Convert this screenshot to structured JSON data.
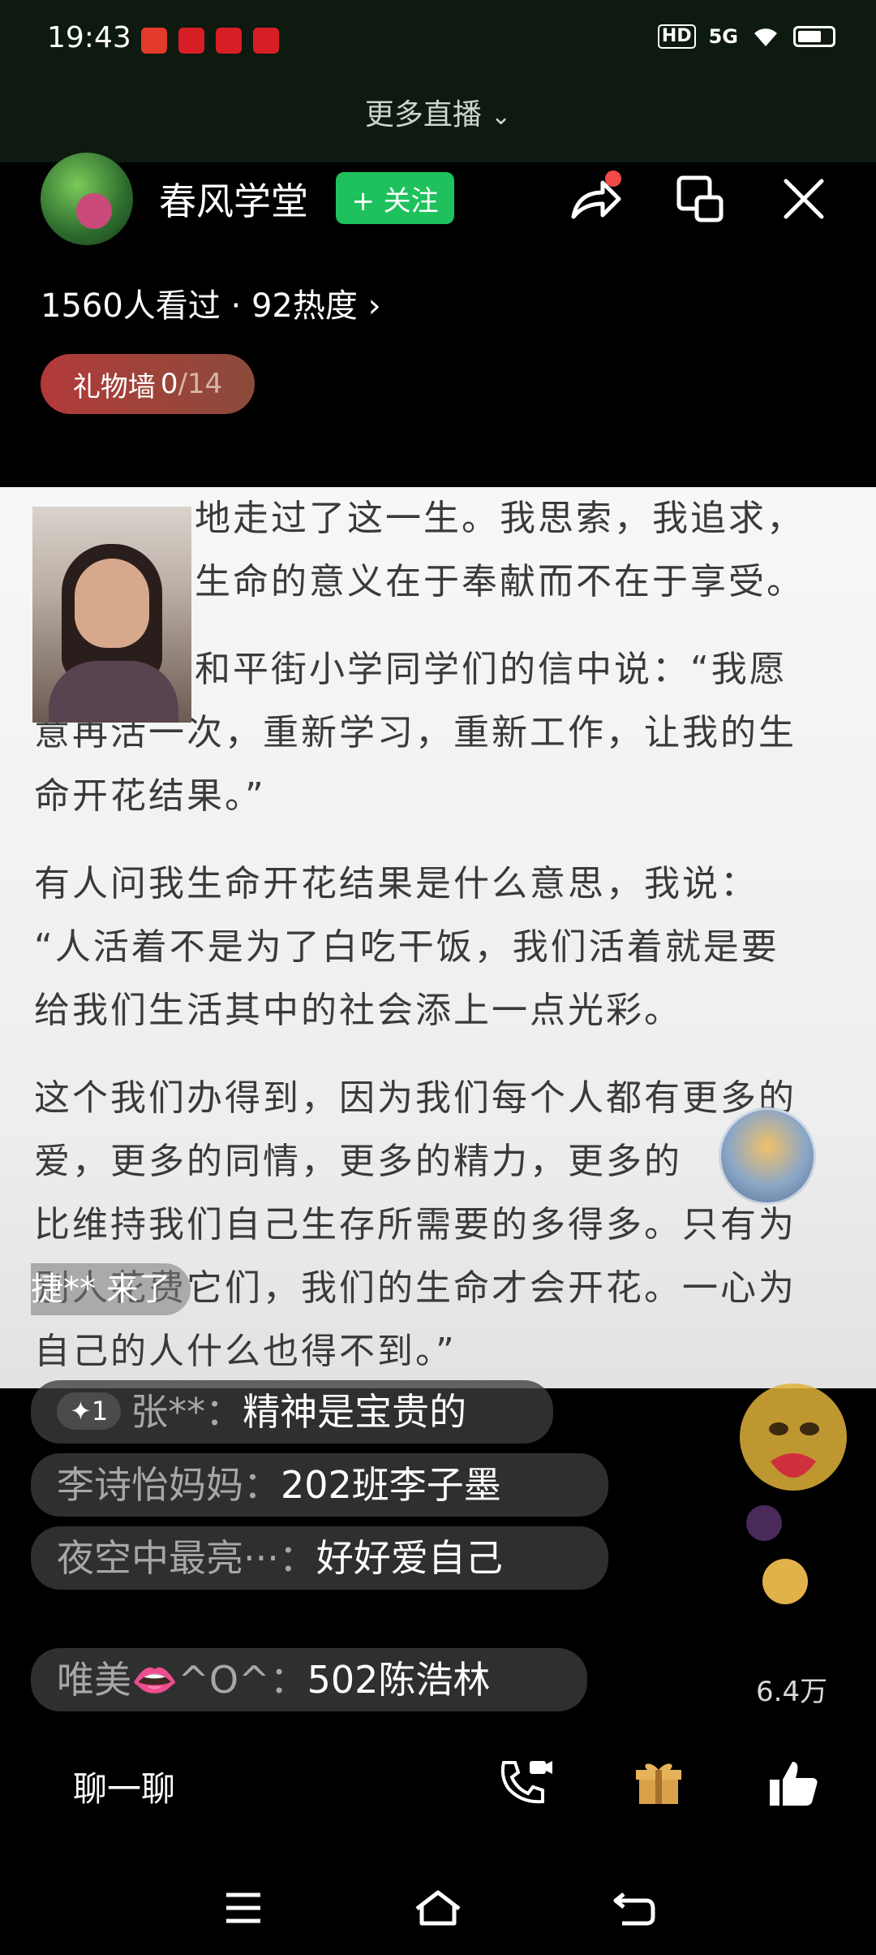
{
  "status_bar": {
    "time": "19:43",
    "network_badge": "HD",
    "signal_label": "5G"
  },
  "more_live": {
    "label": "更多直播"
  },
  "header": {
    "streamer_name": "春风学堂",
    "follow_label": "+ 关注",
    "viewers_text": "1560人看过",
    "heat_text": "92热度",
    "gift_wall_label": "礼物墙",
    "gift_wall_count": "0",
    "gift_wall_max": "/14"
  },
  "document": {
    "paragraphs": [
      "地走过了这一生。我思索，我追求，",
      "生命的意义在于奉献而不在于享受。",
      "和平街小学同学们的信中说：“我愿",
      "意再活一次，重新学习，重新工作，让我的生",
      "命开花结果。”",
      "有人问我生命开花结果是什么意思，我说：",
      "“人活着不是为了白吃干饭，我们活着就是要",
      "给我们生活其中的社会添上一点光彩。",
      "这个我们办得到，因为我们每个人都有更多的",
      "爱，更多的同情，更多的精力，更多的",
      "比维持我们自己生存所需要的多得多。只有为",
      "别人花费它们，我们的生命才会开花。一心为",
      "自己的人什么也得不到。”"
    ]
  },
  "enter_message": "捷** 来了",
  "comments": [
    {
      "badge": "✦1",
      "user": "张**：",
      "text": "精神是宝贵的"
    },
    {
      "badge": "",
      "user": "李诗怡妈妈：",
      "text": "202班李子墨"
    },
    {
      "badge": "",
      "user": "夜空中最亮···：",
      "text": "好好爱自己"
    },
    {
      "badge": "",
      "user": "唯美👄^O^：",
      "text": "502陈浩林"
    }
  ],
  "likes_count": "6.4万",
  "bottom_bar": {
    "chat_label": "聊一聊"
  },
  "colors": {
    "follow_green": "#1fc15c",
    "gift_wall_red": "#b23a3a",
    "gift_gold": "#d9a24a"
  }
}
